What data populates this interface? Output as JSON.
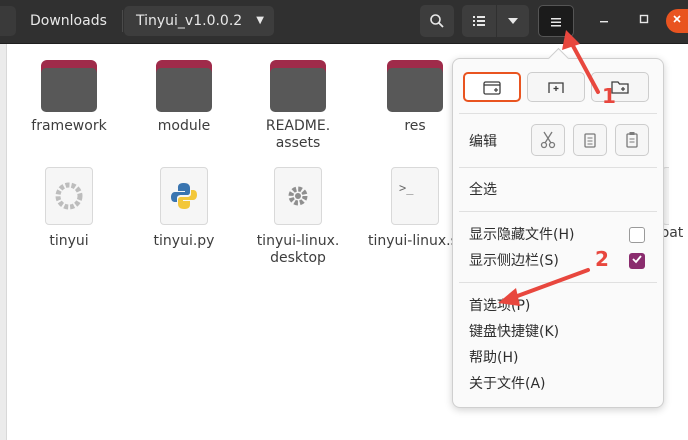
{
  "header": {
    "crumbs": [
      "Downloads",
      "Tinyui_v1.0.0.2"
    ],
    "icons": {
      "search": "search-icon",
      "list": "list-view-icon",
      "view_menu": "chevron-down-icon",
      "menu": "hamburger-menu-icon",
      "minimize": "minimize-icon",
      "maximize": "maximize-icon",
      "close": "close-icon"
    }
  },
  "files": {
    "row1": [
      {
        "name": "framework",
        "type": "folder"
      },
      {
        "name": "module",
        "type": "folder"
      },
      {
        "name": "README.\nassets",
        "type": "folder"
      },
      {
        "name": "res",
        "type": "folder"
      }
    ],
    "row2": [
      {
        "name": "tinyui",
        "type": "executable"
      },
      {
        "name": "tinyui.py",
        "type": "python"
      },
      {
        "name": "tinyui-linux.\ndesktop",
        "type": "desktop"
      },
      {
        "name": "tinyui-linux.s",
        "type": "script"
      },
      {
        "name": "i.bat",
        "type": "script"
      }
    ]
  },
  "menu": {
    "edit_label": "编辑",
    "select_all": "全选",
    "show_hidden": "显示隐藏文件(H)",
    "show_sidebar": "显示侧边栏(S)",
    "preferences": "首选项(P)",
    "shortcuts": "键盘快捷键(K)",
    "help": "帮助(H)",
    "about": "关于文件(A)",
    "show_hidden_checked": false,
    "show_sidebar_checked": true,
    "icons": [
      "new-window-icon",
      "new-tab-icon",
      "new-folder-icon",
      "cut-icon",
      "copy-icon",
      "paste-icon"
    ]
  },
  "annotations": {
    "label1": "1",
    "label2": "2",
    "color": "#e8473e"
  },
  "colors": {
    "accent": "#e95420",
    "folder_tab": "#9f2b4a",
    "folder_body": "#585858",
    "checkbox_on": "#8a2c6e"
  }
}
